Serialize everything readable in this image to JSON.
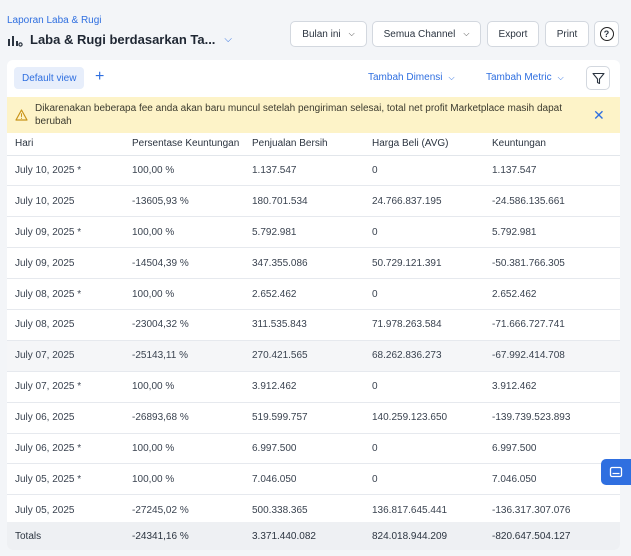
{
  "header": {
    "breadcrumb": "Laporan Laba & Rugi",
    "title": "Laba & Rugi berdasarkan Ta...",
    "buttons": {
      "period": "Bulan ini",
      "channel": "Semua Channel",
      "export": "Export",
      "print": "Print"
    }
  },
  "viewbar": {
    "default_view": "Default view",
    "add_dimension": "Tambah Dimensi",
    "add_metric": "Tambah Metric"
  },
  "warning": {
    "text": "Dikarenakan beberapa fee anda akan baru muncul setelah pengiriman selesai, total net profit Marketplace masih dapat berubah"
  },
  "table": {
    "columns": [
      "Hari",
      "Persentase Keuntungan",
      "Penjualan Bersih",
      "Harga Beli (AVG)",
      "Keuntungan"
    ],
    "rows": [
      [
        "July 10, 2025 *",
        "100,00 %",
        "1.137.547",
        "0",
        "1.137.547"
      ],
      [
        "July 10, 2025",
        "-13605,93 %",
        "180.701.534",
        "24.766.837.195",
        "-24.586.135.661"
      ],
      [
        "July 09, 2025 *",
        "100,00 %",
        "5.792.981",
        "0",
        "5.792.981"
      ],
      [
        "July 09, 2025",
        "-14504,39 %",
        "347.355.086",
        "50.729.121.391",
        "-50.381.766.305"
      ],
      [
        "July 08, 2025 *",
        "100,00 %",
        "2.652.462",
        "0",
        "2.652.462"
      ],
      [
        "July 08, 2025",
        "-23004,32 %",
        "311.535.843",
        "71.978.263.584",
        "-71.666.727.741"
      ],
      [
        "July 07, 2025",
        "-25143,11 %",
        "270.421.565",
        "68.262.836.273",
        "-67.992.414.708"
      ],
      [
        "July 07, 2025 *",
        "100,00 %",
        "3.912.462",
        "0",
        "3.912.462"
      ],
      [
        "July 06, 2025",
        "-26893,68 %",
        "519.599.757",
        "140.259.123.650",
        "-139.739.523.893"
      ],
      [
        "July 06, 2025 *",
        "100,00 %",
        "6.997.500",
        "0",
        "6.997.500"
      ],
      [
        "July 05, 2025 *",
        "100,00 %",
        "7.046.050",
        "0",
        "7.046.050"
      ],
      [
        "July 05, 2025",
        "-27245,02 %",
        "500.338.365",
        "136.817.645.441",
        "-136.317.307.076"
      ]
    ],
    "totals": {
      "label": "Totals",
      "profit_pct": "-24341,16 %",
      "net_sales": "3.371.440.082",
      "avg_cost": "824.018.944.209",
      "profit": "-820.647.504.127"
    }
  },
  "colors": {
    "accent": "#2f6fe0",
    "warning_bg": "#fdf3c8"
  },
  "icons": [
    "chart-icon",
    "chevron-down-icon",
    "help-icon",
    "plus-icon",
    "filter-icon",
    "warning-icon",
    "close-icon",
    "chat-icon"
  ]
}
